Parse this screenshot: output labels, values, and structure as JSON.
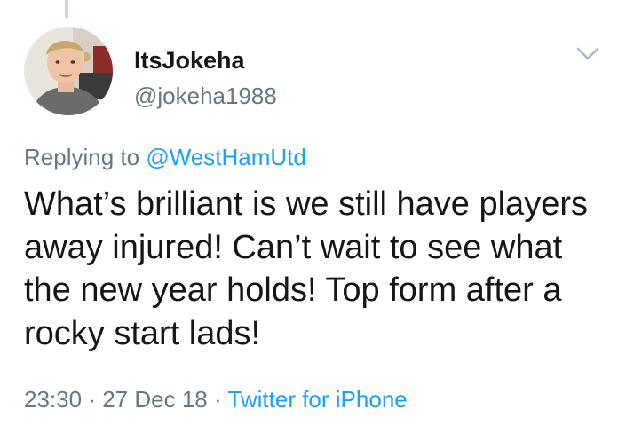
{
  "tweet": {
    "user": {
      "name": "ItsJokeha",
      "handle": "@jokeha1988",
      "avatar_icon": "user-avatar"
    },
    "reply": {
      "prefix": "Replying to",
      "mention": "@WestHamUtd"
    },
    "text": "What’s brilliant is we still have players away injured! Can’t wait to see what the new year holds! Top form after a rocky start lads!",
    "time": "23:30",
    "date": "27 Dec 18",
    "separator": "·",
    "source": "Twitter for iPhone"
  },
  "icons": {
    "menu": "chevron-down-icon"
  },
  "colors": {
    "text": "#14171a",
    "secondary": "#657786",
    "link": "#1da1f2",
    "thread_line": "#ccd6dd",
    "background": "#ffffff"
  }
}
